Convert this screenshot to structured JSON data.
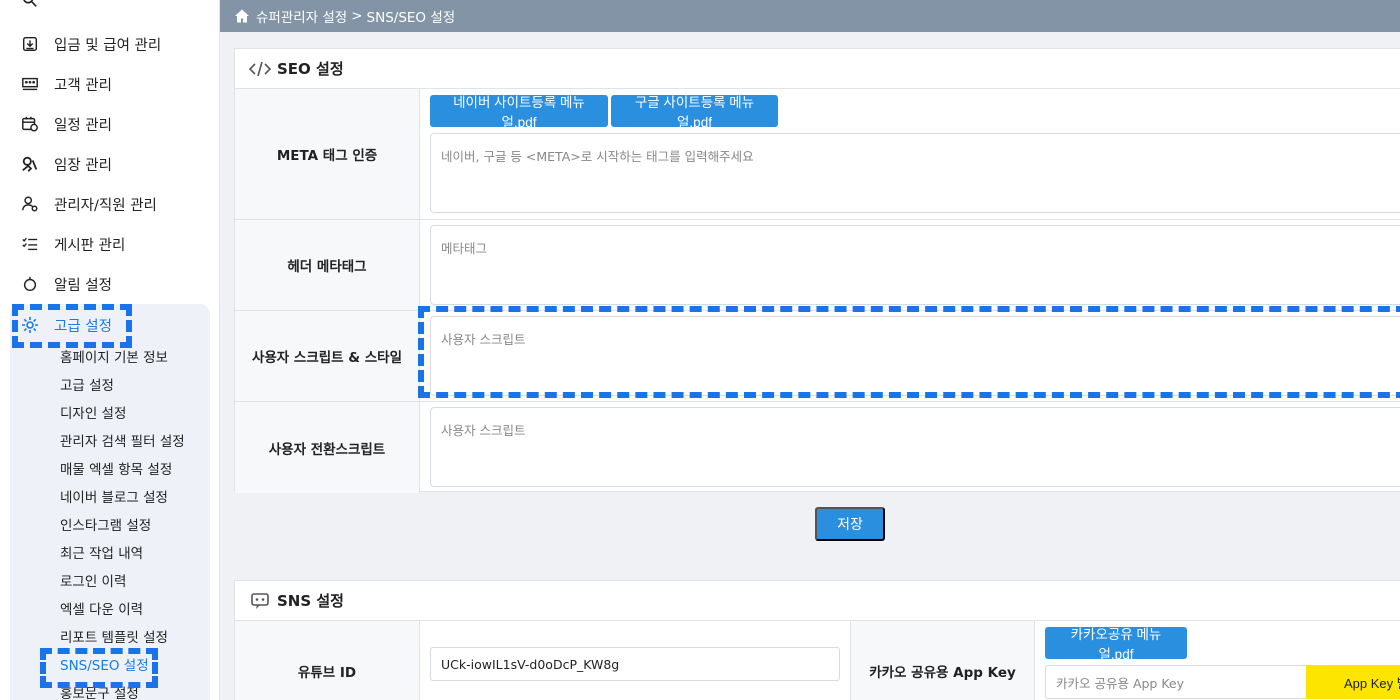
{
  "sidebar": {
    "items": [
      {
        "label": "입금 및 급여 관리",
        "icon": "wallet-download-icon"
      },
      {
        "label": "고객 관리",
        "icon": "users-group-icon"
      },
      {
        "label": "일정 관리",
        "icon": "calendar-clock-icon"
      },
      {
        "label": "임장 관리",
        "icon": "site-visit-icon"
      },
      {
        "label": "관리자/직원 관리",
        "icon": "user-gear-icon"
      },
      {
        "label": "게시판 관리",
        "icon": "list-check-icon"
      },
      {
        "label": "알림 설정",
        "icon": "alarm-icon"
      }
    ],
    "group": {
      "label": "고급 설정",
      "icon": "gear-icon",
      "subitems": [
        "홈페이지 기본 정보",
        "고급 설정",
        "디자인 설정",
        "관리자 검색 필터 설정",
        "매물 엑셀 항목 설정",
        "네이버 블로그 설정",
        "인스타그램 설정",
        "최근 작업 내역",
        "로그인 이력",
        "엑셀 다운 이력",
        "리포트 템플릿 설정",
        "SNS/SEO 설정",
        "홍보문구 설정"
      ],
      "active_index": 11
    }
  },
  "breadcrumb": {
    "root": "슈퍼관리자 설정",
    "separator": ">",
    "current": "SNS/SEO 설정"
  },
  "seo": {
    "title": "SEO 설정",
    "naver_manual": "네이버 사이트등록 메뉴얼.pdf",
    "google_manual": "구글 사이트등록 메뉴얼.pdf",
    "meta": {
      "label": "META 태그 인증",
      "placeholder": "네이버, 구글 등 <META>로 시작하는 태그를 입력해주세요"
    },
    "header_meta": {
      "label": "헤더 메타태그",
      "placeholder": "메타태그"
    },
    "user_script": {
      "label": "사용자 스크립트 & 스타일",
      "placeholder": "사용자 스크립트"
    },
    "conversion_script": {
      "label": "사용자 전환스크립트",
      "placeholder": "사용자 스크립트"
    },
    "save": "저장"
  },
  "sns": {
    "title": "SNS 설정",
    "youtube_label": "유튜브 ID",
    "youtube_value": "UCk-iowIL1sV-d0oDcP_KW8g",
    "kakao_label": "카카오 공유용 App Key",
    "kakao_manual": "카카오공유 메뉴얼.pdf",
    "kakao_placeholder": "카카오 공유용 App Key",
    "appkey_button": "App Key 발"
  },
  "colors": {
    "accent": "#2b8fe0",
    "topbar": "#8494a7",
    "highlight": "#1a73e8",
    "kakao": "#fee500"
  }
}
